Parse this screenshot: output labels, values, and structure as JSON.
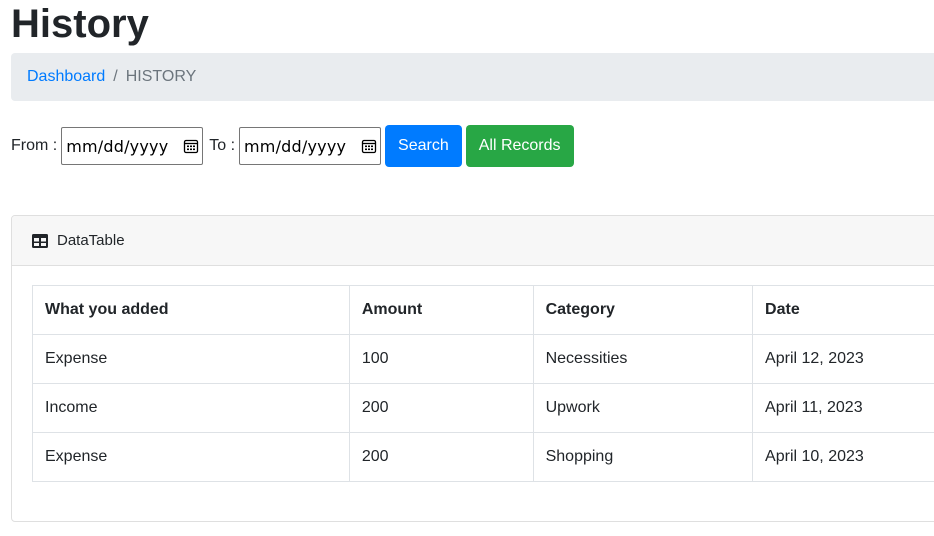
{
  "page": {
    "title": "History"
  },
  "breadcrumb": {
    "link": "Dashboard",
    "separator": "/",
    "current": "HISTORY"
  },
  "filter": {
    "from_label": "From :",
    "to_label": "To :",
    "from_placeholder": "mm/dd/yyyy",
    "to_placeholder": "mm/dd/yyyy",
    "search_button": "Search",
    "all_records_button": "All Records"
  },
  "card": {
    "header": "DataTable",
    "header_icon": "table-icon"
  },
  "table": {
    "headers": [
      "What you added",
      "Amount",
      "Category",
      "Date"
    ],
    "rows": [
      [
        "Expense",
        "100",
        "Necessities",
        "April 12, 2023"
      ],
      [
        "Income",
        "200",
        "Upwork",
        "April 11, 2023"
      ],
      [
        "Expense",
        "200",
        "Shopping",
        "April 10, 2023"
      ]
    ]
  },
  "colors": {
    "primary": "#007bff",
    "success": "#28a745",
    "breadcrumb_bg": "#e9ecef"
  }
}
